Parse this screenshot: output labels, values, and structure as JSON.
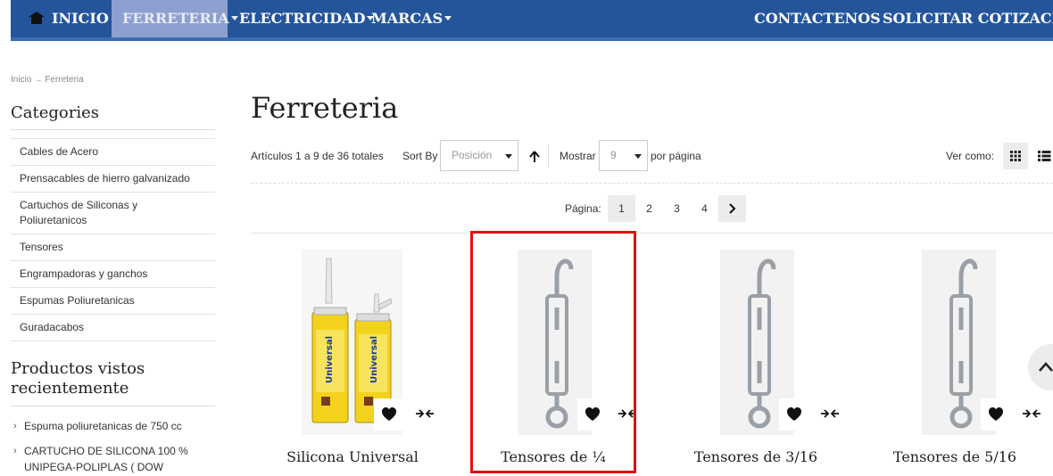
{
  "nav": {
    "home": "INICIO",
    "ferreteria": "FERRETERIA",
    "electricidad": "ELECTRICIDAD",
    "marcas": "MARCAS",
    "contactenos": "CONTACTENOS",
    "cotizacion": "SOLICITAR COTIZACION"
  },
  "breadcrumb": {
    "home": "Inicio",
    "current": "Ferreteria"
  },
  "sidebar": {
    "categories_title": "Categories",
    "categories": [
      "Cables de Acero",
      "Prensacables de hierro galvanizado",
      "Cartuchos de Siliconas y Poliuretanicos",
      "Tensores",
      "Engrampadoras y ganchos",
      "Espumas Poliuretanicas",
      "Guradacabos"
    ],
    "recent_title": "Productos vistos recientemente",
    "recent": [
      "Espuma poliuretanicas de 750 cc",
      "CARTUCHO DE SILICONA 100 % UNIPEGA-POLIPLAS ( DOW"
    ]
  },
  "main": {
    "title": "Ferreteria",
    "count": "Artículos 1 a 9 de 36 totales",
    "sort_label": "Sort By",
    "sort_value": "Posición",
    "show_label": "Mostrar",
    "show_value": "9",
    "per_page": "por página",
    "view_label": "Ver como:",
    "pager_label": "Página:",
    "pages": [
      "1",
      "2",
      "3",
      "4"
    ],
    "current_page": "1"
  },
  "products": [
    {
      "name": "Silicona Universal",
      "image": "silicone-cartridges"
    },
    {
      "name": "Tensores de ¼",
      "image": "turnbuckle"
    },
    {
      "name": "Tensores de 3/16",
      "image": "turnbuckle"
    },
    {
      "name": "Tensores de 5/16",
      "image": "turnbuckle"
    }
  ],
  "colors": {
    "nav_bg": "#24559b",
    "nav_active": "#8da0cf",
    "highlight": "#e01010"
  }
}
